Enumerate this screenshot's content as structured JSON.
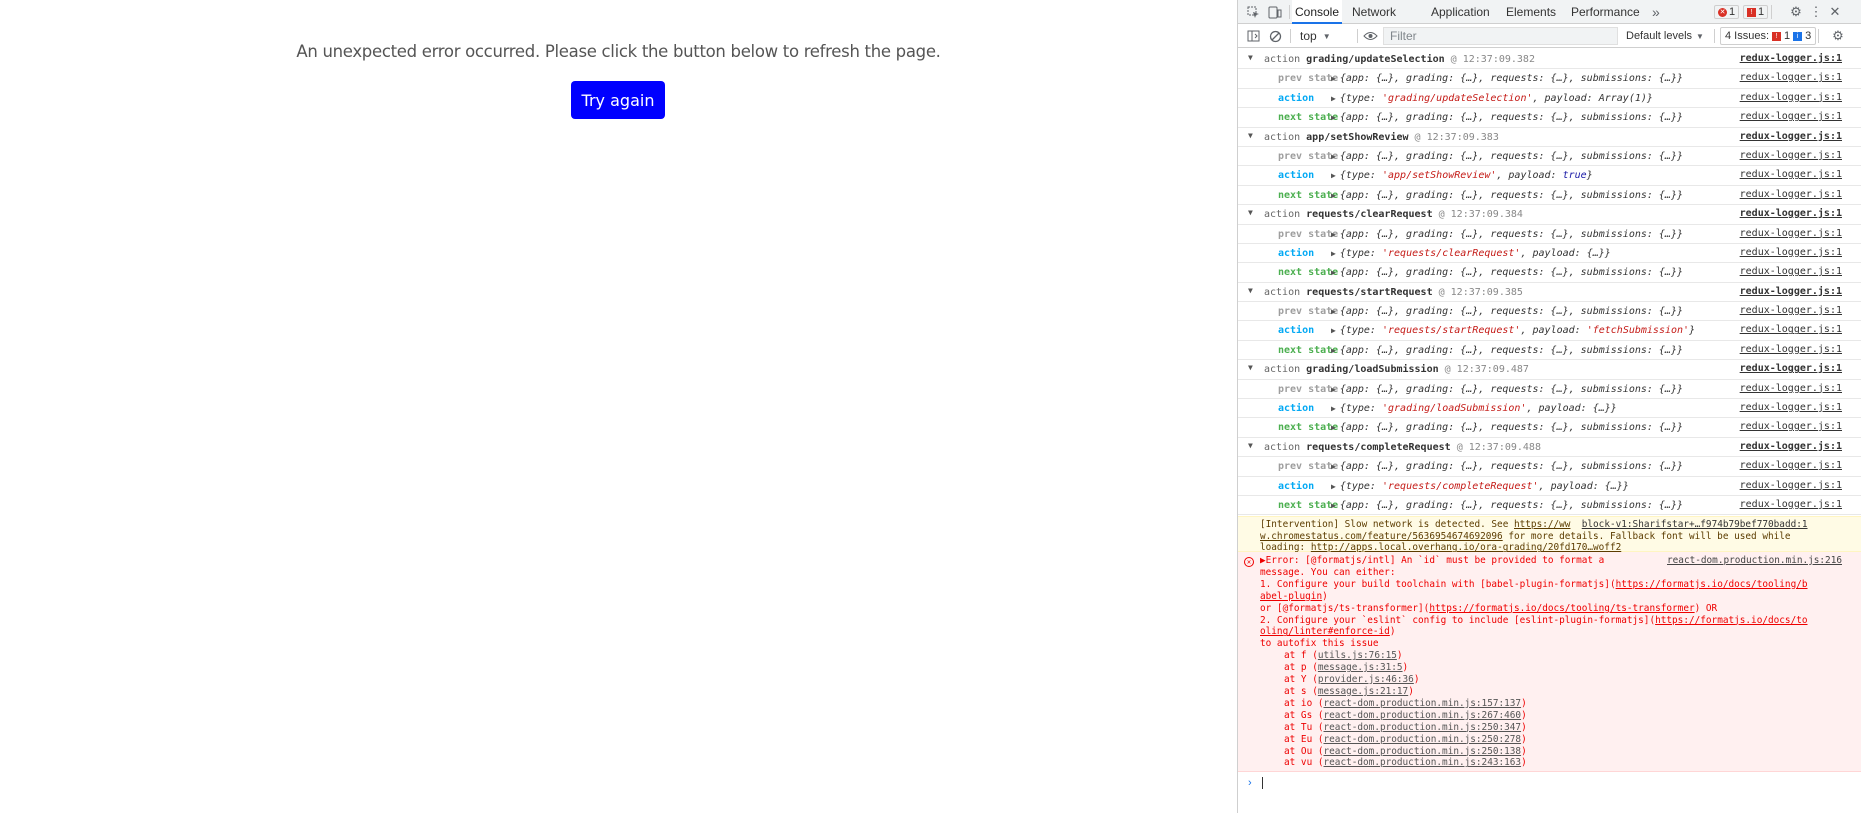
{
  "page": {
    "error_message": "An unexpected error occurred. Please click the button below to refresh the page.",
    "retry_label": "Try again"
  },
  "devtools": {
    "tabs": [
      "Console",
      "Network",
      "Application",
      "Elements",
      "Performance"
    ],
    "more_tabs": "»",
    "error_count": "1",
    "warning_count": "1",
    "toolbar": {
      "context": "top",
      "filter_placeholder": "Filter",
      "levels": "Default levels",
      "issues_label": "4 Issues:",
      "issues_errors": "1",
      "issues_info": "3"
    },
    "log": [
      {
        "kind": "action",
        "name": "grading/updateSelection",
        "time": "@ 12:37:09.382",
        "source": "redux-logger.js:1"
      },
      {
        "kind": "prev",
        "label": "prev state",
        "value": "{app: {…}, grading: {…}, requests: {…}, submissions: {…}}",
        "source": "redux-logger.js:1"
      },
      {
        "kind": "action_obj",
        "label": "action",
        "pre": "{type: ",
        "str": "'grading/updateSelection'",
        "post": ", payload: Array(1)}",
        "source": "redux-logger.js:1"
      },
      {
        "kind": "next",
        "label": "next state",
        "value": "{app: {…}, grading: {…}, requests: {…}, submissions: {…}}",
        "source": "redux-logger.js:1"
      },
      {
        "kind": "action",
        "name": "app/setShowReview",
        "time": "@ 12:37:09.383",
        "source": "redux-logger.js:1"
      },
      {
        "kind": "prev",
        "label": "prev state",
        "value": "{app: {…}, grading: {…}, requests: {…}, submissions: {…}}",
        "source": "redux-logger.js:1"
      },
      {
        "kind": "action_obj",
        "label": "action",
        "pre": "{type: ",
        "str": "'app/setShowReview'",
        "post": ", payload: ",
        "kw": "true",
        "post2": "}",
        "source": "redux-logger.js:1"
      },
      {
        "kind": "next",
        "label": "next state",
        "value": "{app: {…}, grading: {…}, requests: {…}, submissions: {…}}",
        "source": "redux-logger.js:1"
      },
      {
        "kind": "action",
        "name": "requests/clearRequest",
        "time": "@ 12:37:09.384",
        "source": "redux-logger.js:1"
      },
      {
        "kind": "prev",
        "label": "prev state",
        "value": "{app: {…}, grading: {…}, requests: {…}, submissions: {…}}",
        "source": "redux-logger.js:1"
      },
      {
        "kind": "action_obj",
        "label": "action",
        "pre": "{type: ",
        "str": "'requests/clearRequest'",
        "post": ", payload: {…}}",
        "source": "redux-logger.js:1"
      },
      {
        "kind": "next",
        "label": "next state",
        "value": "{app: {…}, grading: {…}, requests: {…}, submissions: {…}}",
        "source": "redux-logger.js:1"
      },
      {
        "kind": "action",
        "name": "requests/startRequest",
        "time": "@ 12:37:09.385",
        "source": "redux-logger.js:1"
      },
      {
        "kind": "prev",
        "label": "prev state",
        "value": "{app: {…}, grading: {…}, requests: {…}, submissions: {…}}",
        "source": "redux-logger.js:1"
      },
      {
        "kind": "action_obj",
        "label": "action",
        "pre": "{type: ",
        "str": "'requests/startRequest'",
        "post": ", payload: ",
        "str2": "'fetchSubmission'",
        "post2": "}",
        "source": "redux-logger.js:1"
      },
      {
        "kind": "next",
        "label": "next state",
        "value": "{app: {…}, grading: {…}, requests: {…}, submissions: {…}}",
        "source": "redux-logger.js:1"
      },
      {
        "kind": "action",
        "name": "grading/loadSubmission",
        "time": "@ 12:37:09.487",
        "source": "redux-logger.js:1"
      },
      {
        "kind": "prev",
        "label": "prev state",
        "value": "{app: {…}, grading: {…}, requests: {…}, submissions: {…}}",
        "source": "redux-logger.js:1"
      },
      {
        "kind": "action_obj",
        "label": "action",
        "pre": "{type: ",
        "str": "'grading/loadSubmission'",
        "post": ", payload: {…}}",
        "source": "redux-logger.js:1"
      },
      {
        "kind": "next",
        "label": "next state",
        "value": "{app: {…}, grading: {…}, requests: {…}, submissions: {…}}",
        "source": "redux-logger.js:1"
      },
      {
        "kind": "action",
        "name": "requests/completeRequest",
        "time": "@ 12:37:09.488",
        "source": "redux-logger.js:1"
      },
      {
        "kind": "prev",
        "label": "prev state",
        "value": "{app: {…}, grading: {…}, requests: {…}, submissions: {…}}",
        "source": "redux-logger.js:1"
      },
      {
        "kind": "action_obj",
        "label": "action",
        "pre": "{type: ",
        "str": "'requests/completeRequest'",
        "post": ", payload: {…}}",
        "source": "redux-logger.js:1"
      },
      {
        "kind": "next",
        "label": "next state",
        "value": "{app: {…}, grading: {…}, requests: {…}, submissions: {…}}",
        "source": "redux-logger.js:1"
      }
    ],
    "intervention": {
      "text1": "[Intervention] Slow network is detected. See ",
      "link1": "https://ww",
      "source": "block-v1:Sharifstar+…f974b79bef770badd:1",
      "link2": "w.chromestatus.com/feature/5636954674692096",
      "text2": " for more details. Fallback font will be used while",
      "text3": "loading: ",
      "link3": "http://apps.local.overhang.io/ora-grading/20fd170…woff2"
    },
    "error": {
      "source": "react-dom.production.min.js:216",
      "lines": [
        "▶Error: [@formatjs/intl] An `id` must be provided to format a",
        "message. You can either:",
        "1. Configure your build toolchain with [babel-plugin-formatjs](",
        "https://formatjs.io/docs/tooling/b",
        "abel-plugin",
        "or [@formatjs/ts-transformer](",
        "https://formatjs.io/docs/tooling/ts-transformer",
        ") OR",
        "2. Configure your `eslint` config to include [eslint-plugin-formatjs](",
        "https://formatjs.io/docs/to",
        "oling/linter#enforce-id",
        "to autofix this issue"
      ],
      "stack": [
        {
          "fn": "at f (",
          "loc": "utils.js:76:15"
        },
        {
          "fn": "at p (",
          "loc": "message.js:31:5"
        },
        {
          "fn": "at Y (",
          "loc": "provider.js:46:36"
        },
        {
          "fn": "at s (",
          "loc": "message.js:21:17"
        },
        {
          "fn": "at io (",
          "loc": "react-dom.production.min.js:157:137"
        },
        {
          "fn": "at Gs (",
          "loc": "react-dom.production.min.js:267:460"
        },
        {
          "fn": "at Tu (",
          "loc": "react-dom.production.min.js:250:347"
        },
        {
          "fn": "at Eu (",
          "loc": "react-dom.production.min.js:250:278"
        },
        {
          "fn": "at Ou (",
          "loc": "react-dom.production.min.js:250:138"
        },
        {
          "fn": "at vu (",
          "loc": "react-dom.production.min.js:243:163"
        }
      ]
    },
    "colors": {
      "button": "#0000ff",
      "tab_accent": "#1a73e8",
      "prev_state": "#9e9e9e",
      "action": "#03a9f4",
      "next_state": "#4caf50",
      "error_text": "#ee0000",
      "error_bg": "#fff0f0",
      "warning_bg": "#fffbe5"
    }
  }
}
